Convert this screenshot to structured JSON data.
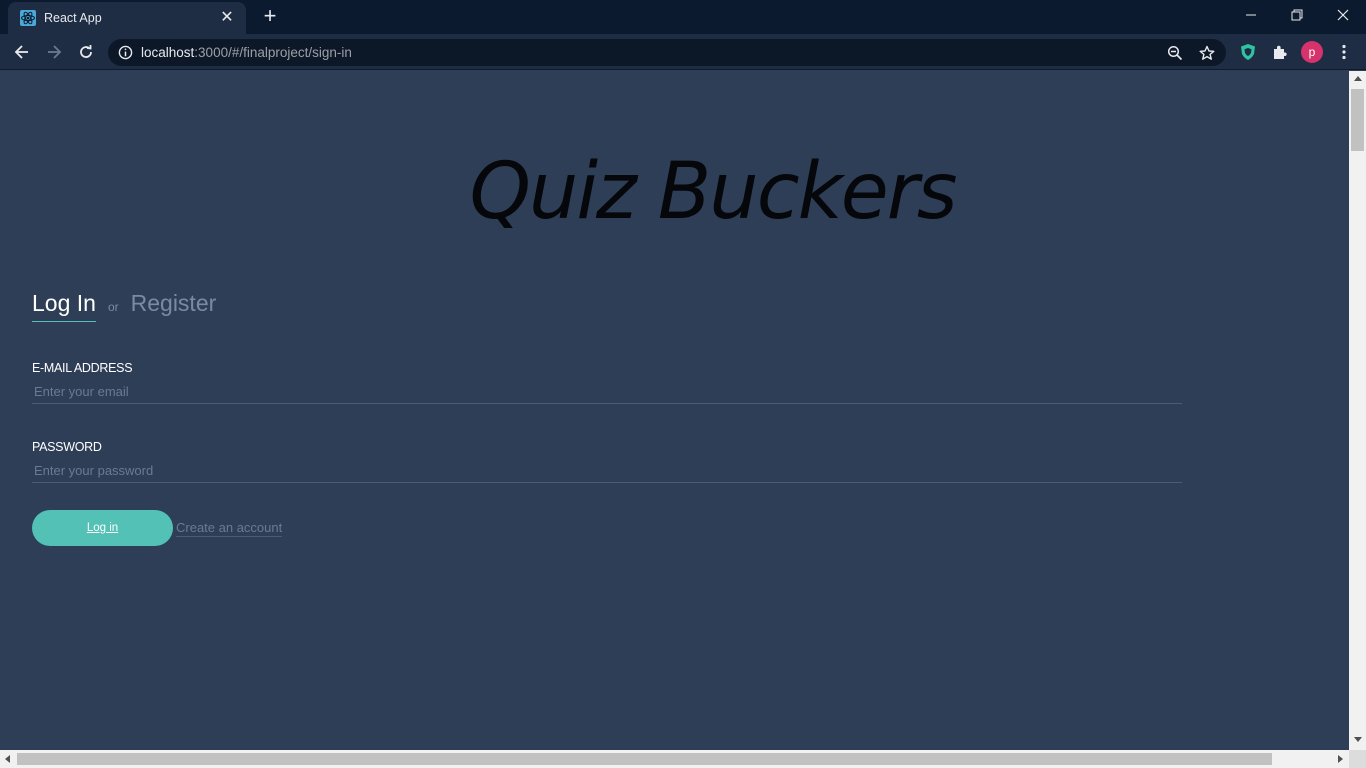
{
  "browser": {
    "tab_title": "React App",
    "new_tab_symbol": "+",
    "close_tab_symbol": "✕",
    "url_host": "localhost",
    "url_rest": ":3000/#/finalproject/sign-in",
    "profile_initial": "p",
    "colors": {
      "chrome_dark": "#0c1a30",
      "toolbar": "#1e2d43",
      "profile": "#d6336c"
    }
  },
  "page": {
    "brand_title": "Quiz Buckers",
    "tabs": {
      "login": "Log In",
      "or": "or",
      "register": "Register"
    },
    "email": {
      "label": "E-MAIL ADDRESS",
      "placeholder": "Enter your email",
      "value": ""
    },
    "password": {
      "label": "PASSWORD",
      "placeholder": "Enter your password",
      "value": ""
    },
    "login_button": "Log in",
    "create_account_link": "Create an account",
    "colors": {
      "background": "#2e3e56",
      "accent": "#53c1b6",
      "muted": "#7b8aa1"
    }
  },
  "icons": {
    "favicon": "react-icon",
    "back": "back-arrow-icon",
    "forward": "forward-arrow-icon",
    "reload": "reload-icon",
    "site_info": "info-icon",
    "zoom": "zoom-icon",
    "bookmark": "star-icon",
    "shield": "shield-extension-icon",
    "extensions": "puzzle-icon",
    "menu": "kebab-menu-icon"
  }
}
